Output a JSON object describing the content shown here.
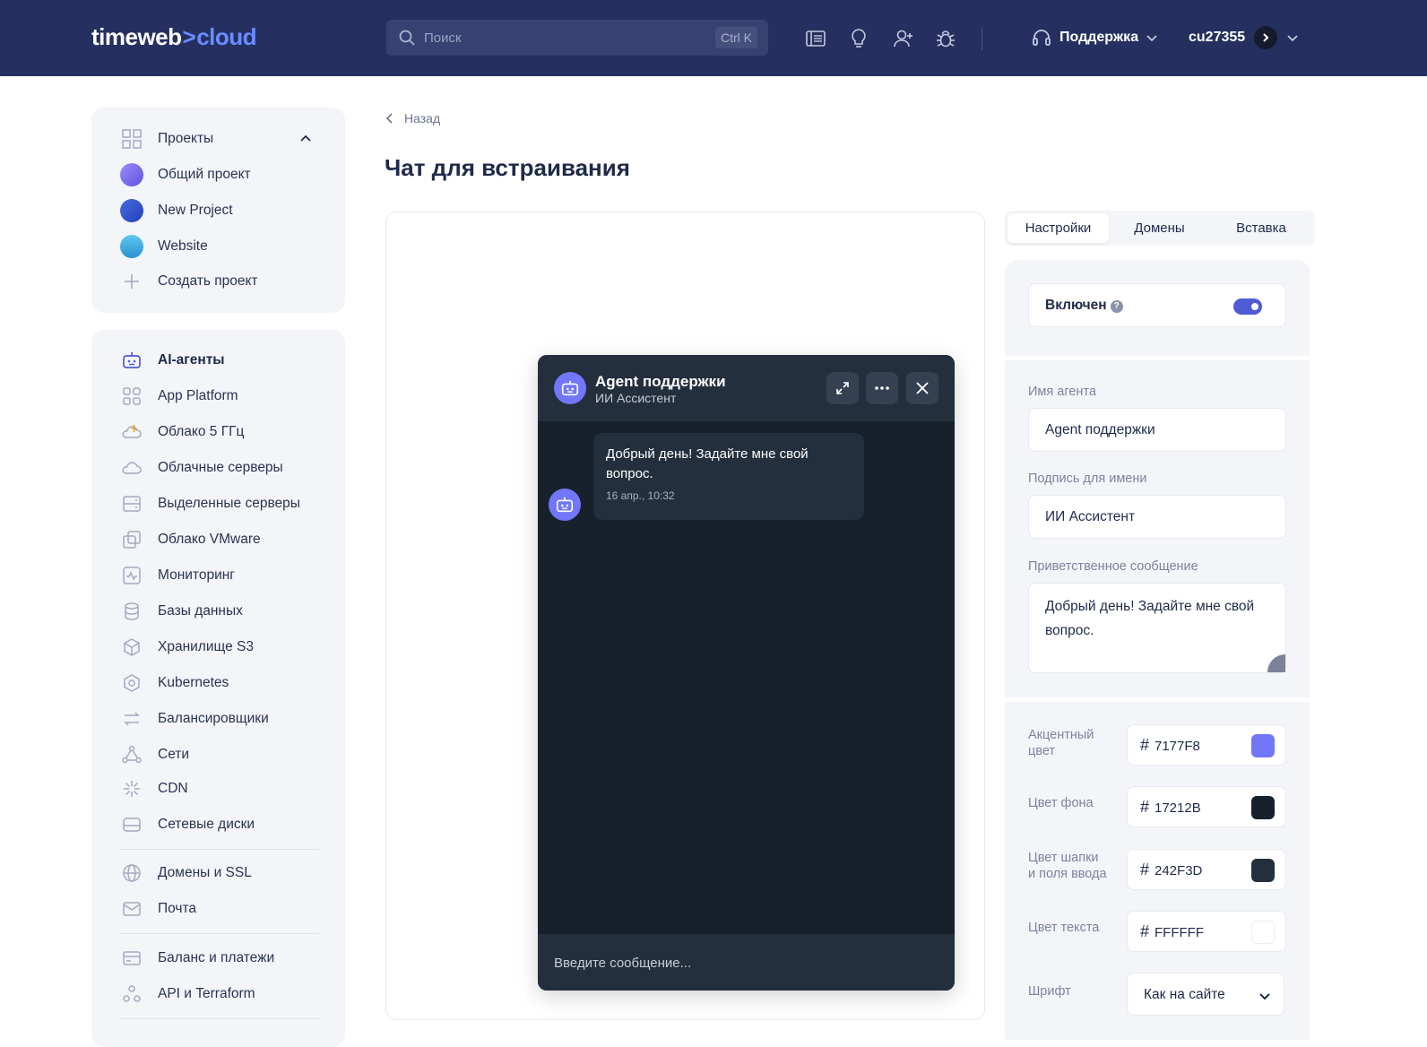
{
  "brand": {
    "name_left": "timeweb",
    "name_arrow": ">",
    "name_right": "cloud"
  },
  "search": {
    "placeholder": "Поиск",
    "shortcut": "Ctrl K"
  },
  "topbar": {
    "icons": [
      "docs-icon",
      "lightbulb-icon",
      "add-user-icon",
      "bug-icon"
    ],
    "support_label": "Поддержка",
    "user_label": "cu27355"
  },
  "sidebar": {
    "projects": {
      "header": "Проекты",
      "items": [
        {
          "label": "Общий проект",
          "color": "#7a6cf0"
        },
        {
          "label": "New Project",
          "color": "#3d63d8"
        },
        {
          "label": "Website",
          "color": "#3ab0e8"
        }
      ],
      "create_label": "Создать проект"
    },
    "services": [
      {
        "label": "AI-агенты",
        "icon": "robot-icon",
        "active": true
      },
      {
        "label": "App Platform",
        "icon": "grid-icon"
      },
      {
        "label": "Облако 5 ГГц",
        "icon": "lightning-cloud-icon"
      },
      {
        "label": "Облачные серверы",
        "icon": "cloud-icon"
      },
      {
        "label": "Выделенные серверы",
        "icon": "server-icon"
      },
      {
        "label": "Облако VMware",
        "icon": "vmware-icon"
      },
      {
        "label": "Мониторинг",
        "icon": "monitoring-icon"
      },
      {
        "label": "Базы данных",
        "icon": "database-icon"
      },
      {
        "label": "Хранилище S3",
        "icon": "cube-icon"
      },
      {
        "label": "Kubernetes",
        "icon": "kubernetes-icon"
      },
      {
        "label": "Балансировщики",
        "icon": "arrows-icon"
      },
      {
        "label": "Сети",
        "icon": "network-icon"
      },
      {
        "label": "CDN",
        "icon": "cdn-icon"
      },
      {
        "label": "Сетевые диски",
        "icon": "disk-icon"
      }
    ],
    "extra": [
      {
        "label": "Домены и SSL",
        "icon": "globe-icon"
      },
      {
        "label": "Почта",
        "icon": "mail-icon"
      }
    ],
    "billing": [
      {
        "label": "Баланс и платежи",
        "icon": "card-icon"
      },
      {
        "label": "API и Terraform",
        "icon": "api-icon"
      }
    ]
  },
  "main": {
    "back_label": "Назад",
    "title": "Чат для встраивания"
  },
  "chat": {
    "agent_name": "Agent поддержки",
    "agent_subtitle": "ИИ Ассистент",
    "message_text": "Добрый день! Задайте мне свой вопрос.",
    "message_time": "16 апр., 10:32",
    "input_placeholder": "Введите сообщение..."
  },
  "settings": {
    "tabs": [
      "Настройки",
      "Домены",
      "Вставка"
    ],
    "active_tab": "Настройки",
    "enabled_label": "Включен",
    "enabled": true,
    "agent_name_label": "Имя агента",
    "agent_name_value": "Agent поддержки",
    "signature_label": "Подпись для имени",
    "signature_value": "ИИ Ассистент",
    "greeting_label": "Приветственное сообщение",
    "greeting_value": "Добрый день! Задайте мне свой вопрос.",
    "colors": [
      {
        "label_line1": "Акцентный",
        "label_line2": "цвет",
        "hex": "7177F8",
        "swatch": "#7177F8"
      },
      {
        "label_line1": "Цвет фона",
        "label_line2": "",
        "hex": "17212B",
        "swatch": "#17212B"
      },
      {
        "label_line1": "Цвет шапки",
        "label_line2": "и поля ввода",
        "hex": "242F3D",
        "swatch": "#242F3D"
      },
      {
        "label_line1": "Цвет текста",
        "label_line2": "",
        "hex": "FFFFFF",
        "swatch": "#FFFFFF"
      }
    ],
    "font_label": "Шрифт",
    "font_value": "Как на сайте"
  },
  "palette": {
    "topbar_bg": "#253060",
    "accent": "#7177F8",
    "toggle_on": "#4F5BD5"
  }
}
